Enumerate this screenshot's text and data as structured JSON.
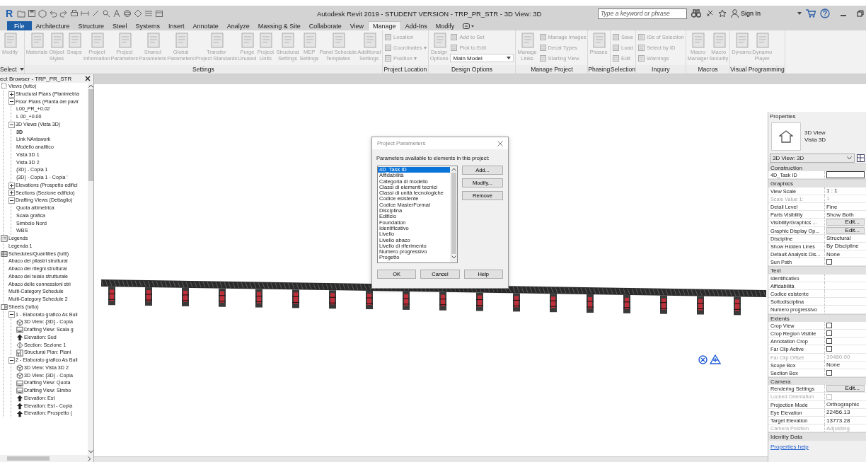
{
  "window": {
    "logo": "R",
    "title": "Autodesk Revit 2019 - STUDENT VERSION - TRP_PR_STR - 3D View: 3D",
    "search": {
      "placeholder": "Type a keyword or phrase"
    },
    "sign_in": "Sign In"
  },
  "tabs": [
    {
      "label": "File",
      "kind": "app",
      "selected": false
    },
    {
      "label": "Architecture",
      "kind": "tab",
      "selected": false
    },
    {
      "label": "Structure",
      "kind": "tab",
      "selected": false
    },
    {
      "label": "Steel",
      "kind": "tab",
      "selected": false
    },
    {
      "label": "Systems",
      "kind": "tab",
      "selected": false
    },
    {
      "label": "Insert",
      "kind": "tab",
      "selected": false
    },
    {
      "label": "Annotate",
      "kind": "tab",
      "selected": false
    },
    {
      "label": "Analyze",
      "kind": "tab",
      "selected": false
    },
    {
      "label": "Massing & Site",
      "kind": "tab",
      "selected": false
    },
    {
      "label": "Collaborate",
      "kind": "tab",
      "selected": false
    },
    {
      "label": "View",
      "kind": "tab",
      "selected": false
    },
    {
      "label": "Manage",
      "kind": "tab",
      "selected": true
    },
    {
      "label": "Add-Ins",
      "kind": "tab",
      "selected": false
    },
    {
      "label": "Modify",
      "kind": "tab",
      "selected": false
    }
  ],
  "ribbon": [
    {
      "title": "Select",
      "dropdown": true,
      "groups": [
        {
          "kind": "large",
          "items": [
            {
              "label": "Modify",
              "disabled": true
            }
          ]
        }
      ]
    },
    {
      "title": "Settings",
      "dropdown": false,
      "groups": [
        {
          "kind": "large",
          "items": [
            {
              "label": "Materials",
              "disabled": true
            },
            {
              "label": "Object\nStyles",
              "disabled": true
            },
            {
              "label": "Snaps",
              "disabled": true
            },
            {
              "label": "Project\nInformation",
              "disabled": true
            },
            {
              "label": "Project\nParameters",
              "disabled": true
            },
            {
              "label": "Shared\nParameters",
              "disabled": true
            },
            {
              "label": "Global\nParameters",
              "disabled": true
            },
            {
              "label": "Transfer\nProject Standards",
              "disabled": true
            },
            {
              "label": "Purge\nUnused",
              "disabled": true
            },
            {
              "label": "Project\nUnits",
              "disabled": true
            }
          ]
        },
        {
          "kind": "large",
          "items": [
            {
              "label": "Structural\nSettings",
              "disabled": true
            },
            {
              "label": "MEP\nSettings",
              "disabled": true
            },
            {
              "label": "Panel Schedule\nTemplates",
              "disabled": true
            },
            {
              "label": "Additional\nSettings",
              "disabled": true
            }
          ]
        }
      ]
    },
    {
      "title": "Project Location",
      "dropdown": false,
      "groups": [
        {
          "kind": "small",
          "items": [
            {
              "label": "Location",
              "disabled": true
            },
            {
              "label": "Coordinates ▾",
              "disabled": true
            },
            {
              "label": "Position ▾",
              "disabled": true
            }
          ]
        }
      ]
    },
    {
      "title": "Design Options",
      "dropdown": false,
      "groups": [
        {
          "kind": "large",
          "items": [
            {
              "label": "Design\nOptions",
              "disabled": true
            }
          ]
        },
        {
          "kind": "small",
          "items": [
            {
              "label": "Add to Set",
              "disabled": true
            },
            {
              "label": "Pick to Edit",
              "disabled": true
            }
          ],
          "select": "Main Model"
        }
      ]
    },
    {
      "title": "Manage Project",
      "dropdown": false,
      "groups": [
        {
          "kind": "large",
          "items": [
            {
              "label": "Manage\nLinks",
              "disabled": true
            }
          ]
        },
        {
          "kind": "small",
          "items": [
            {
              "label": "Manage Images",
              "disabled": true
            },
            {
              "label": "Decal Types",
              "disabled": true
            },
            {
              "label": "Starting View",
              "disabled": true
            }
          ]
        }
      ]
    },
    {
      "title": "Phasing",
      "dropdown": false,
      "groups": [
        {
          "kind": "large",
          "items": [
            {
              "label": "Phases",
              "disabled": true
            }
          ]
        }
      ]
    },
    {
      "title": "Selection",
      "dropdown": false,
      "groups": [
        {
          "kind": "small",
          "items": [
            {
              "label": "Save",
              "disabled": true
            },
            {
              "label": "Load",
              "disabled": true
            },
            {
              "label": "Edit",
              "disabled": true
            }
          ]
        }
      ]
    },
    {
      "title": "Inquiry",
      "dropdown": false,
      "groups": [
        {
          "kind": "small",
          "items": [
            {
              "label": "IDs of Selection",
              "disabled": true
            },
            {
              "label": "Select by ID",
              "disabled": true
            },
            {
              "label": "Warnings",
              "disabled": true
            }
          ]
        }
      ]
    },
    {
      "title": "Macros",
      "dropdown": false,
      "groups": [
        {
          "kind": "large",
          "items": [
            {
              "label": "Macro\nManager",
              "disabled": true
            },
            {
              "label": "Macro\nSecurity",
              "disabled": true
            }
          ]
        }
      ]
    },
    {
      "title": "Visual Programming",
      "dropdown": false,
      "groups": [
        {
          "kind": "large",
          "items": [
            {
              "label": "Dynamo",
              "disabled": true
            },
            {
              "label": "Dynamo\nPlayer",
              "disabled": true
            }
          ]
        }
      ]
    }
  ],
  "project_browser": {
    "title": "ect Browser - TRP_PR_STR",
    "tree": [
      {
        "label": "Views (tutto)",
        "kind": "views",
        "children": [
          {
            "label": "Structural Plans (Planimetria",
            "expanded": false
          },
          {
            "label": "Floor Plans (Pianta del pavir",
            "expanded": true,
            "children": [
              {
                "label": "L00_PR_+0.02"
              },
              {
                "label": "L 00_+0.00"
              }
            ]
          },
          {
            "label": "3D Views (Vista 3D)",
            "expanded": true,
            "children": [
              {
                "label": "3D",
                "active": true
              },
              {
                "label": "Link NAviswork",
                "active": false
              },
              {
                "label": "Modello analitico",
                "active": false
              },
              {
                "label": "Vista 3D 1",
                "active": false
              },
              {
                "label": "Vista 3D 2",
                "active": false
              },
              {
                "label": "{3D} - Copia 1",
                "active": false
              },
              {
                "label": "{3D} - Copia 1 - Copia '",
                "active": false
              }
            ]
          },
          {
            "label": "Elevations (Prospetto edifici",
            "expanded": false
          },
          {
            "label": "Sections (Sezione edificio)",
            "expanded": false
          },
          {
            "label": "Drafting Views (Dettaglio)",
            "expanded": true,
            "children": [
              {
                "label": "Quota altimetrica"
              },
              {
                "label": "Scala grafica"
              },
              {
                "label": "Simbolo Nord"
              },
              {
                "label": "WBS"
              }
            ]
          }
        ]
      },
      {
        "label": "Legends",
        "kind": "legend",
        "children": [
          {
            "label": "Legenda 1"
          }
        ]
      },
      {
        "label": "Schedules/Quantities (tutti)",
        "kind": "schedule",
        "children": [
          {
            "label": "Abaco dei pilastri struttural"
          },
          {
            "label": "Abaco dei ritegni struttural"
          },
          {
            "label": "Abaco del telaio strutturale"
          },
          {
            "label": "Abaco delle connessioni stri"
          },
          {
            "label": "Multi-Category Schedule"
          },
          {
            "label": "Multi-Category Schedule 2"
          }
        ]
      },
      {
        "label": "Sheets (tutto)",
        "kind": "sheet",
        "children": [
          {
            "label": "1 - Elaborato grafico As Buil",
            "expanded": true,
            "children": [
              {
                "label": "3D View: {3D} - Copia",
                "kind": "view3d"
              },
              {
                "label": "Drafting View: Scala g",
                "kind": "drafting"
              },
              {
                "label": "Elevation: Sud",
                "kind": "elevation"
              },
              {
                "label": "Section: Sezione 1",
                "kind": "section"
              },
              {
                "label": "Structural Plan: Plani",
                "kind": "plan"
              }
            ]
          },
          {
            "label": "2 - Elaborato grafico As Buil",
            "expanded": true,
            "children": [
              {
                "label": "3D View: Vista 3D 2",
                "kind": "view3d"
              },
              {
                "label": "3D View: {3D} - Copia",
                "kind": "view3d"
              },
              {
                "label": "Drafting View: Quota",
                "kind": "drafting"
              },
              {
                "label": "Drafting View: Simbo",
                "kind": "drafting"
              },
              {
                "label": "Elevation: Est",
                "kind": "elevation"
              },
              {
                "label": "Elevation: Est - Copia",
                "kind": "elevation"
              },
              {
                "label": "Elevation: Prospetto (",
                "kind": "elevation"
              }
            ]
          }
        ]
      }
    ]
  },
  "dialog": {
    "title": "Project Parameters",
    "prompt": "Parameters available to elements in this project:",
    "parameters": [
      {
        "label": "4D_Task ID",
        "selected": true
      },
      {
        "label": "Affidabilità",
        "selected": false
      },
      {
        "label": "Categoria di modello",
        "selected": false
      },
      {
        "label": "Classi di elementi tecnici",
        "selected": false
      },
      {
        "label": "Classi di unità tecnologiche",
        "selected": false
      },
      {
        "label": "Codice esistente",
        "selected": false
      },
      {
        "label": "Codice MasterFormat",
        "selected": false
      },
      {
        "label": "Disciplina",
        "selected": false
      },
      {
        "label": "Edificio",
        "selected": false
      },
      {
        "label": "Foundation",
        "selected": false
      },
      {
        "label": "Identificativo",
        "selected": false
      },
      {
        "label": "Livello",
        "selected": false
      },
      {
        "label": "Livello abaco",
        "selected": false
      },
      {
        "label": "Livello di riferimento",
        "selected": false
      },
      {
        "label": "Numero progressivo",
        "selected": false
      },
      {
        "label": "Progetto",
        "selected": false
      }
    ],
    "side_buttons": [
      "Add...",
      "Modify...",
      "Remove"
    ],
    "buttons": [
      "OK",
      "Cancel",
      "Help"
    ]
  },
  "properties": {
    "title": "Properties",
    "type_name": "3D View",
    "type_sub": "Vista 3D",
    "selector": "3D View: 3D",
    "rows": [
      {
        "kind": "header",
        "label": "Construction"
      },
      {
        "kind": "input",
        "label": "4D_Task ID",
        "disabled": false
      },
      {
        "kind": "header",
        "label": "Graphics"
      },
      {
        "kind": "text",
        "label": "View Scale",
        "value": "1 : 1",
        "disabled": false
      },
      {
        "kind": "text",
        "label": "Scale Value    1:",
        "value": "1",
        "disabled": true
      },
      {
        "kind": "text",
        "label": "Detail Level",
        "value": "Fine",
        "disabled": false
      },
      {
        "kind": "text",
        "label": "Parts Visibility",
        "value": "Show Both",
        "disabled": false
      },
      {
        "kind": "button",
        "label": "Visibility/Graphics ...",
        "value": "Edit...",
        "disabled": false
      },
      {
        "kind": "button",
        "label": "Graphic Display Op...",
        "value": "Edit...",
        "disabled": false
      },
      {
        "kind": "text",
        "label": "Discipline",
        "value": "Structural",
        "disabled": false
      },
      {
        "kind": "text",
        "label": "Show Hidden Lines",
        "value": "By Discipline",
        "disabled": false
      },
      {
        "kind": "text",
        "label": "Default Analysis Dis...",
        "value": "None",
        "disabled": false
      },
      {
        "kind": "checkbox",
        "label": "Sun Path",
        "checked": false,
        "disabled": false
      },
      {
        "kind": "header",
        "label": "Text"
      },
      {
        "kind": "text",
        "label": "Identificativo",
        "disabled": false
      },
      {
        "kind": "text",
        "label": "Affidabilità",
        "disabled": false
      },
      {
        "kind": "text",
        "label": "Codice esistente",
        "disabled": false
      },
      {
        "kind": "text",
        "label": "Sottodisciplina",
        "disabled": false
      },
      {
        "kind": "text",
        "label": "Numero progressivo",
        "disabled": false
      },
      {
        "kind": "header",
        "label": "Extents"
      },
      {
        "kind": "checkbox",
        "label": "Crop View",
        "checked": false,
        "disabled": false
      },
      {
        "kind": "checkbox",
        "label": "Crop Region Visible",
        "checked": false,
        "disabled": false
      },
      {
        "kind": "checkbox",
        "label": "Annotation Crop",
        "checked": false,
        "disabled": false
      },
      {
        "kind": "checkbox",
        "label": "Far Clip Active",
        "checked": false,
        "disabled": false
      },
      {
        "kind": "text",
        "label": "Far Clip Offset",
        "value": "30480.00",
        "disabled": true
      },
      {
        "kind": "text",
        "label": "Scope Box",
        "value": "None",
        "disabled": false
      },
      {
        "kind": "checkbox",
        "label": "Section Box",
        "checked": false,
        "disabled": false
      },
      {
        "kind": "header",
        "label": "Camera"
      },
      {
        "kind": "button",
        "label": "Rendering Settings",
        "value": "Edit...",
        "disabled": false
      },
      {
        "kind": "checkbox",
        "label": "Locked Orientation",
        "checked": false,
        "disabled": true
      },
      {
        "kind": "text",
        "label": "Projection Mode",
        "value": "Orthographic",
        "disabled": false
      },
      {
        "kind": "text",
        "label": "Eye Elevation",
        "value": "22456.13",
        "disabled": false
      },
      {
        "kind": "text",
        "label": "Target Elevation",
        "value": "13773.28",
        "disabled": false
      },
      {
        "kind": "text",
        "label": "Camera Position",
        "value": "Adjusting",
        "disabled": true
      },
      {
        "kind": "header",
        "label": "Identity Data"
      }
    ],
    "help_link": "Properties help"
  }
}
